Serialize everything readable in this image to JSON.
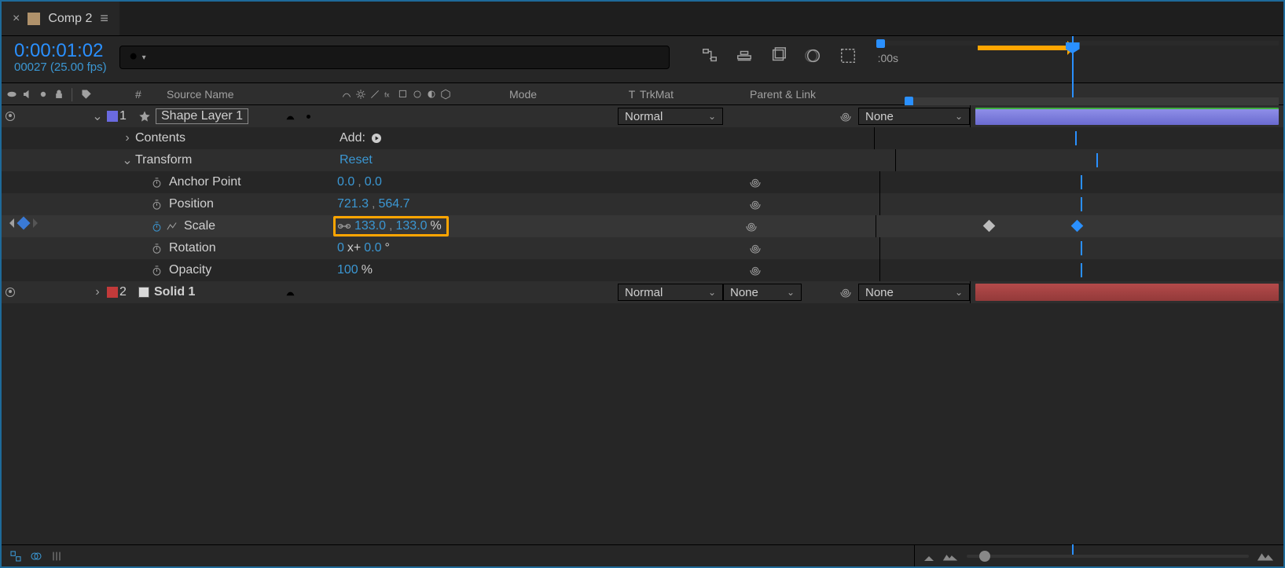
{
  "tab": {
    "title": "Comp 2"
  },
  "timecode": {
    "value": "0:00:01:02",
    "frames": "00027 (25.00 fps)"
  },
  "search": {
    "placeholder": ""
  },
  "ruler": {
    "start_label": ":00s"
  },
  "columns": {
    "hash": "#",
    "source": "Source Name",
    "mode": "Mode",
    "t": "T",
    "trkmat": "TrkMat",
    "parent": "Parent & Link"
  },
  "layer1": {
    "index": "1",
    "name": "Shape Layer 1",
    "mode": "Normal",
    "parent": "None",
    "contents_label": "Contents",
    "add_label": "Add:",
    "transform_label": "Transform",
    "reset_label": "Reset",
    "anchor": {
      "label": "Anchor Point",
      "x": "0.0",
      "y": "0.0"
    },
    "position": {
      "label": "Position",
      "x": "721.3",
      "y": "564.7"
    },
    "scale": {
      "label": "Scale",
      "x": "133.0",
      "y": "133.0",
      "unit": "%"
    },
    "rotation": {
      "label": "Rotation",
      "turns": "0",
      "deg": "0.0"
    },
    "opacity": {
      "label": "Opacity",
      "value": "100",
      "unit": "%"
    }
  },
  "layer2": {
    "index": "2",
    "name": "Solid 1",
    "mode": "Normal",
    "trkmat": "None",
    "parent": "None"
  },
  "colors": {
    "shape_swatch": "#6a6ae0",
    "solid_swatch": "#c23a3a",
    "solid_icon": "#d9d9d9"
  }
}
